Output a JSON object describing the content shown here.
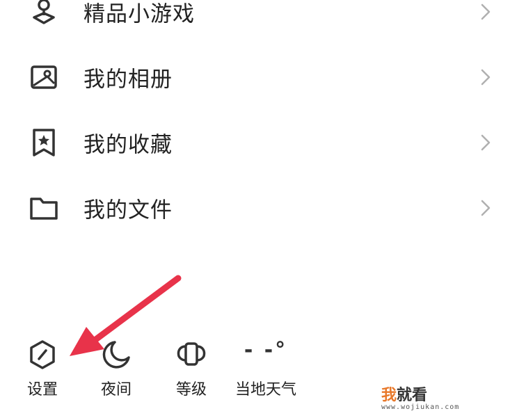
{
  "menu": {
    "items": [
      {
        "label": "精品小游戏",
        "icon": "game-pin-icon"
      },
      {
        "label": "我的相册",
        "icon": "photo-album-icon"
      },
      {
        "label": "我的收藏",
        "icon": "bookmark-star-icon"
      },
      {
        "label": "我的文件",
        "icon": "folder-icon"
      }
    ],
    "chevron_icon": "chevron-right-icon"
  },
  "toolbar": {
    "settings_label": "设置",
    "night_label": "夜间",
    "level_label": "等级",
    "weather_label": "当地天气",
    "weather_temp": "- -°"
  },
  "watermark": {
    "brand_a": "我",
    "brand_b": "就看",
    "url": "www.wojiukan.com"
  },
  "colors": {
    "arrow": "#e8334a",
    "icon": "#333333",
    "chevron": "#b0b0b0",
    "watermark_accent": "#e8782a"
  }
}
